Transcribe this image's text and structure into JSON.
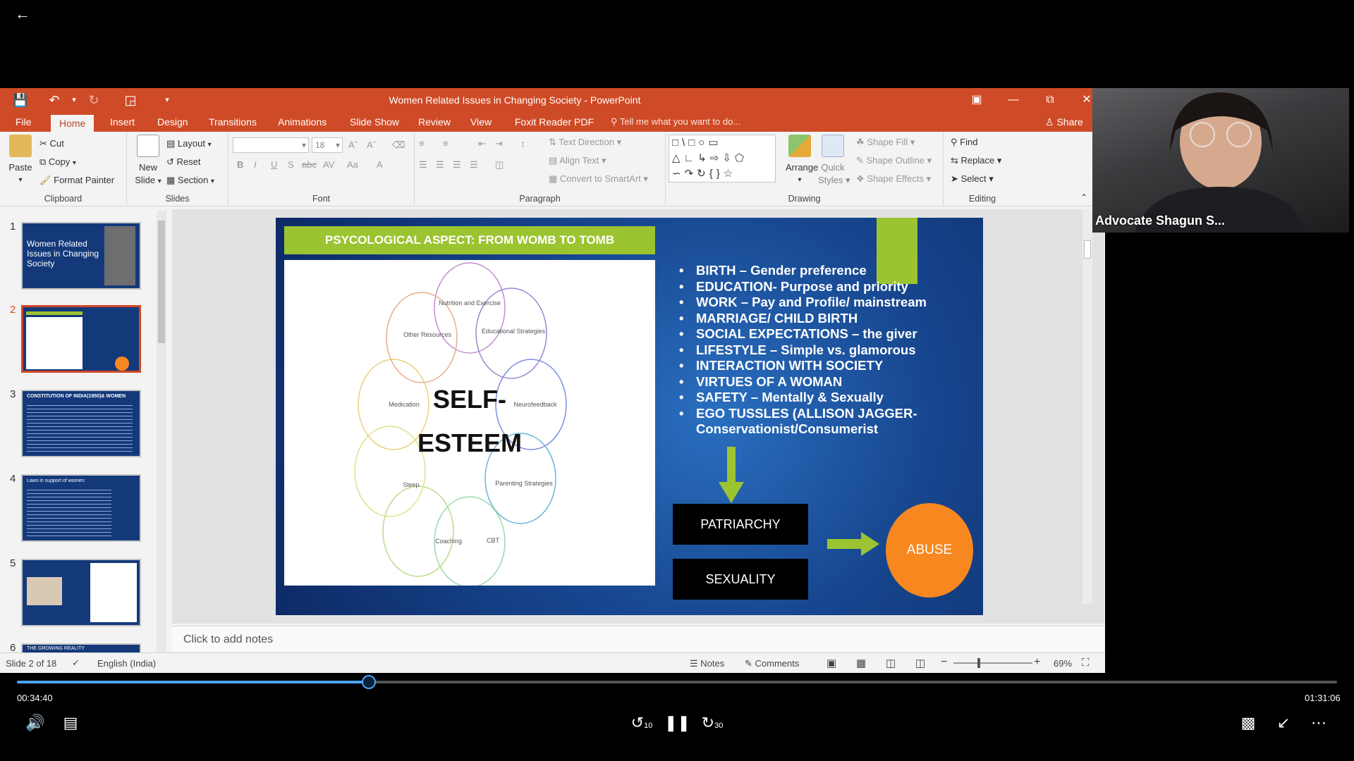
{
  "player": {
    "back_icon": "arrow-left-icon",
    "elapsed": "00:34:40",
    "duration": "01:31:06",
    "progress_fraction": 0.2665,
    "skip_back_label": "10",
    "skip_forward_label": "30"
  },
  "ppt": {
    "title": "Women Related Issues in Changing Society - PowerPoint",
    "tabs": [
      "File",
      "Home",
      "Insert",
      "Design",
      "Transitions",
      "Animations",
      "Slide Show",
      "Review",
      "View",
      "Foxit Reader PDF"
    ],
    "active_tab": "Home",
    "tell_me": "Tell me what you want to do...",
    "share": "Share",
    "ribbon": {
      "clipboard": {
        "label": "Clipboard",
        "paste": "Paste",
        "cut": "Cut",
        "copy": "Copy",
        "format_painter": "Format Painter"
      },
      "slides": {
        "label": "Slides",
        "new_slide_line1": "New",
        "new_slide_line2": "Slide",
        "layout": "Layout",
        "reset": "Reset",
        "section": "Section"
      },
      "font": {
        "label": "Font",
        "font_size": "18"
      },
      "paragraph": {
        "label": "Paragraph",
        "text_direction": "Text Direction",
        "align_text": "Align Text",
        "convert_smartart": "Convert to SmartArt"
      },
      "drawing": {
        "label": "Drawing",
        "arrange": "Arrange",
        "quick_styles_line1": "Quick",
        "quick_styles_line2": "Styles",
        "shape_fill": "Shape Fill",
        "shape_outline": "Shape Outline",
        "shape_effects": "Shape Effects"
      },
      "editing": {
        "label": "Editing",
        "find": "Find",
        "replace": "Replace",
        "select": "Select"
      }
    },
    "thumbnails": [
      {
        "num": "1",
        "title": "Women Related Issues in Changing Society"
      },
      {
        "num": "2",
        "title": ""
      },
      {
        "num": "3",
        "title": "CONSTITUTION OF INDIA(1950)& WOMEN"
      },
      {
        "num": "4",
        "title": "Laws in support of women:"
      },
      {
        "num": "5",
        "title": ""
      },
      {
        "num": "6",
        "title": "THE GROWING REALITY"
      }
    ],
    "notes_placeholder": "Click to add notes",
    "status": {
      "slide": "Slide 2 of 18",
      "language": "English (India)",
      "notes": "Notes",
      "comments": "Comments",
      "zoom": "69%"
    }
  },
  "slide": {
    "title": "PSYCOLOGICAL ASPECT: FROM WOMB TO TOMB",
    "diagram_center_line1": "SELF-",
    "diagram_center_line2": "ESTEEM",
    "petals": [
      "Nutrition and Exercise",
      "Educational Strategies",
      "Neurofeedback",
      "Parenting Strategies",
      "CBT",
      "Coaching",
      "Sleep",
      "Medication",
      "Other Resources"
    ],
    "bullets": [
      "BIRTH – Gender preference",
      "EDUCATION- Purpose and priority",
      "WORK – Pay and Profile/ mainstream",
      "MARRIAGE/ CHILD BIRTH",
      "SOCIAL EXPECTATIONS – the giver",
      "LIFESTYLE – Simple vs. glamorous",
      "INTERACTION WITH SOCIETY",
      "VIRTUES OF A WOMAN",
      "SAFETY – Mentally & Sexually",
      "EGO TUSSLES (ALLISON JAGGER-Conservationist/Consumerist"
    ],
    "box_patriarchy": "PATRIARCHY",
    "box_sexuality": "SEXUALITY",
    "abuse": "ABUSE",
    "colors": {
      "green": "#9cc330",
      "orange": "#f7881f",
      "blue": "#17468f"
    }
  },
  "webcam": {
    "name": "Advocate Shagun S..."
  }
}
